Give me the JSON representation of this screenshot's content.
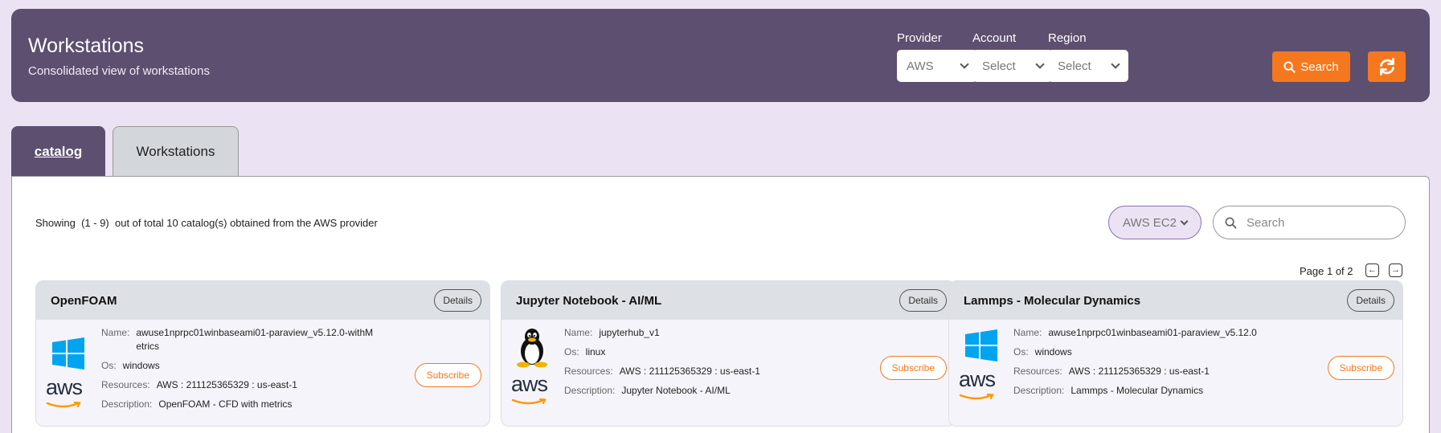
{
  "header": {
    "title": "Workstations",
    "subtitle": "Consolidated view of workstations",
    "filters": {
      "provider": {
        "label": "Provider",
        "value": "AWS"
      },
      "account": {
        "label": "Account",
        "value": "Select"
      },
      "region": {
        "label": "Region",
        "value": "Select"
      }
    },
    "search_label": "Search"
  },
  "tabs": [
    {
      "label": "catalog",
      "active": true
    },
    {
      "label": "Workstations",
      "active": false
    }
  ],
  "catalog": {
    "showing_text": "Showing  (1 - 9)  out of total 10 catalog(s) obtained from the AWS provider",
    "service_filter": "AWS EC2",
    "search_placeholder": "Search",
    "page_info": "Page 1 of 2"
  },
  "labels": {
    "name": "Name:",
    "os": "Os:",
    "resources": "Resources:",
    "description": "Description:",
    "details": "Details",
    "subscribe": "Subscribe"
  },
  "cards": [
    {
      "title": "OpenFOAM",
      "name": "awuse1nprpc01winbaseami01-paraview_v5.12.0-withMetrics",
      "os": "windows",
      "resources": "AWS : 211125365329 : us-east-1",
      "description": "OpenFOAM - CFD with metrics",
      "os_icon": "windows-icon"
    },
    {
      "title": "Jupyter Notebook - AI/ML",
      "name": "jupyterhub_v1",
      "os": "linux",
      "resources": "AWS : 211125365329 : us-east-1",
      "description": "Jupyter Notebook - AI/ML",
      "os_icon": "linux-penguin-icon"
    },
    {
      "title": "Lammps - Molecular Dynamics",
      "name": "awuse1nprpc01winbaseami01-paraview_v5.12.0",
      "os": "windows",
      "resources": "AWS : 211125365329 : us-east-1",
      "description": "Lammps - Molecular Dynamics",
      "os_icon": "windows-icon"
    }
  ],
  "colors": {
    "header_bg": "#5d4f6f",
    "page_bg": "#ebe3f4",
    "accent_orange": "#f6781e",
    "windows_blue": "#00a4ef",
    "aws_orange": "#ff9900"
  }
}
